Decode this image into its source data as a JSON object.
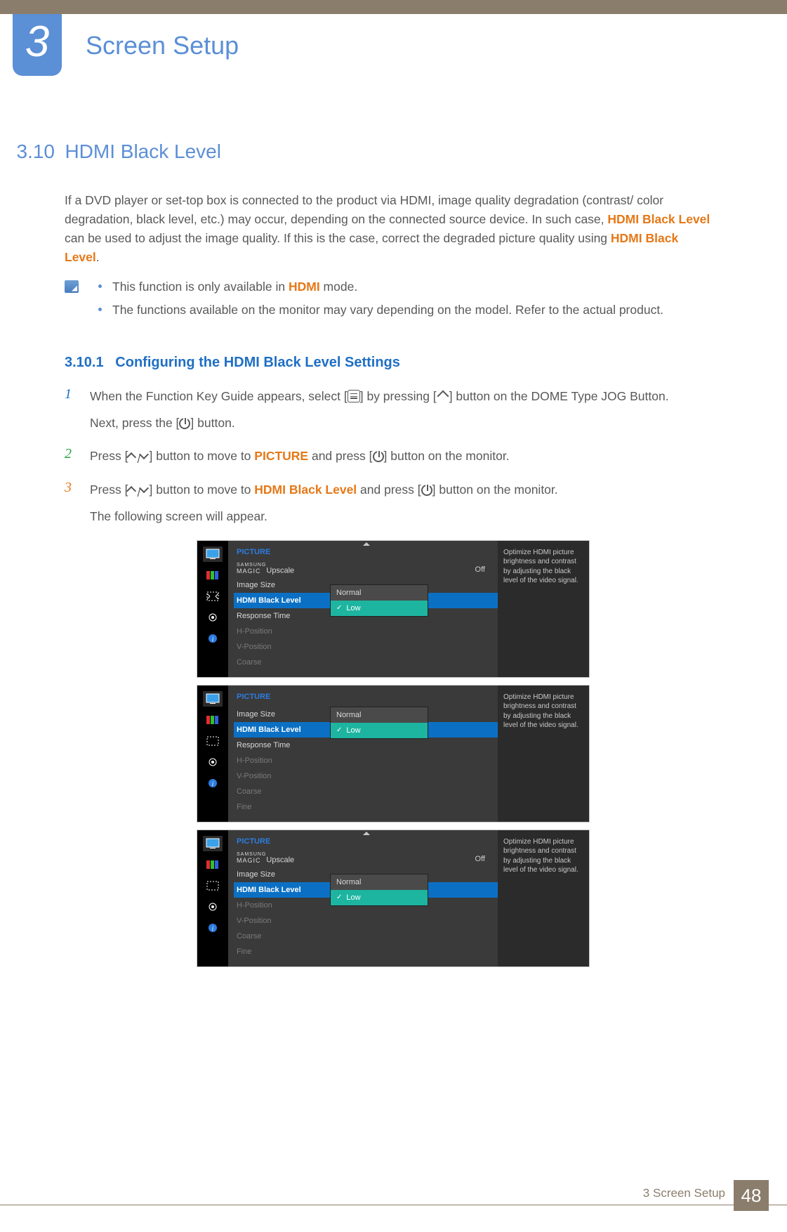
{
  "chapter": {
    "number": "3",
    "title": "Screen Setup"
  },
  "section": {
    "number": "3.10",
    "title": "HDMI Black Level"
  },
  "intro": {
    "p1a": "If a DVD player or set-top box is connected to the product via HDMI, image quality degradation (contrast/ color degradation, black level, etc.) may occur, depending on the connected source device. In such case, ",
    "hl1": "HDMI Black Level",
    "p1b": " can be used to adjust the image quality. If this is the case, correct the degraded picture quality using ",
    "hl2": "HDMI Black Level",
    "p1c": "."
  },
  "notes": {
    "n1a": "This function is only available in ",
    "n1hl": "HDMI",
    "n1b": " mode.",
    "n2": "The functions available on the monitor may vary depending on the model. Refer to the actual product."
  },
  "subsection": {
    "number": "3.10.1",
    "title": "Configuring the HDMI Black Level Settings"
  },
  "steps": {
    "s1a": "When the Function Key Guide appears, select [",
    "s1b": "] by pressing [",
    "s1c": "] button on the DOME Type JOG Button.",
    "s1d": "Next, press the [",
    "s1e": "] button.",
    "s2a": "Press [",
    "s2b": "] button to move to ",
    "s2hl": "PICTURE",
    "s2c": " and press [",
    "s2d": "] button on the monitor.",
    "s3a": "Press [",
    "s3b": "] button to move to ",
    "s3hl": "HDMI Black Level",
    "s3c": " and press [",
    "s3d": "] button on the monitor.",
    "s3e": "The following screen will appear."
  },
  "osd": {
    "title": "PICTURE",
    "help": "Optimize HDMI picture brightness and contrast by adjusting the black level of the video signal.",
    "off": "Off",
    "upscale": "Upscale",
    "magic_top": "SAMSUNG",
    "magic_bot": "MAGIC",
    "items": {
      "imagesize": "Image Size",
      "hdmi": "HDMI Black Level",
      "response": "Response Time",
      "hpos": "H-Position",
      "vpos": "V-Position",
      "coarse": "Coarse",
      "fine": "Fine"
    },
    "options": {
      "normal": "Normal",
      "low": "Low"
    }
  },
  "footer": {
    "label": "3 Screen Setup",
    "page": "48"
  }
}
